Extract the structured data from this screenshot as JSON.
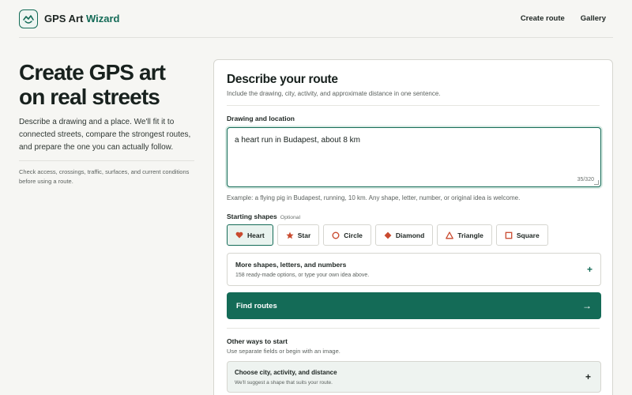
{
  "header": {
    "brand_prefix": "GPS Art",
    "brand_accent": "Wizard",
    "logo_icon": "map-heart-icon",
    "nav": [
      {
        "label": "Create route"
      },
      {
        "label": "Gallery"
      }
    ]
  },
  "hero": {
    "title": "Create GPS art on real streets",
    "intro": "Describe a drawing and a place. We'll fit it to connected streets, compare the strongest routes, and prepare the one you can actually follow.",
    "note": "Check access, crossings, traffic, surfaces, and current conditions before using a route."
  },
  "form": {
    "title": "Describe your route",
    "subtitle": "Include the drawing, city, activity, and approximate distance in one sentence.",
    "field_label": "Drawing and location",
    "field_value": "a heart run in Budapest, about 8 km",
    "char_count": "35/320",
    "example": "Example: a flying pig in Budapest, running, 10 km. Any shape, letter, number, or original idea is welcome.",
    "shapes_label": "Starting shapes",
    "shapes_optional": "Optional",
    "shapes": [
      {
        "label": "Heart",
        "icon": "heart-icon",
        "active": true
      },
      {
        "label": "Star",
        "icon": "star-icon",
        "active": false
      },
      {
        "label": "Circle",
        "icon": "circle-icon",
        "active": false
      },
      {
        "label": "Diamond",
        "icon": "diamond-icon",
        "active": false
      },
      {
        "label": "Triangle",
        "icon": "triangle-icon",
        "active": false
      },
      {
        "label": "Square",
        "icon": "square-icon",
        "active": false
      }
    ],
    "more_title": "More shapes, letters, and numbers",
    "more_subtitle": "158 ready-made options, or type your own idea above.",
    "more_icon": "+",
    "find_label": "Find routes",
    "find_icon": "→",
    "other_title": "Other ways to start",
    "other_subtitle": "Use separate fields or begin with an image.",
    "choose_title": "Choose city, activity, and distance",
    "choose_subtitle": "We'll suggest a shape that suits your route.",
    "choose_icon": "+"
  },
  "colors": {
    "accent": "#146b57",
    "icon_red": "#c94a2f",
    "background": "#f6f6f3"
  }
}
